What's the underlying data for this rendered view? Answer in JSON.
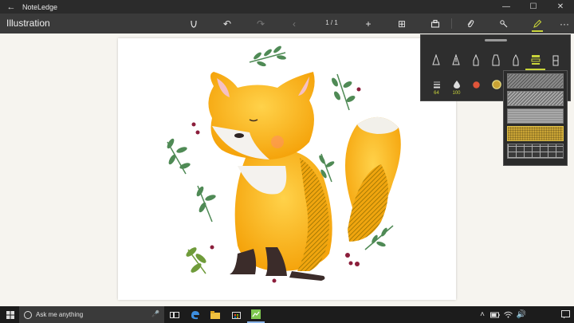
{
  "window": {
    "title": "NoteLedge"
  },
  "toolbar": {
    "doc_title": "Illustration",
    "page_indicator": "1 / 1"
  },
  "pen_panel": {
    "size_value": "64",
    "opacity_value": "100"
  },
  "search": {
    "placeholder": "Ask me anything"
  },
  "colors": {
    "accent": "#c8d43a",
    "ink_color": "#e0553a",
    "fox_orange": "#f5ad12",
    "leaf_green": "#4f8a55"
  },
  "icons": {
    "pens": [
      "fountain-pen-icon",
      "calligraphy-pen-icon",
      "fine-pen-icon",
      "marker-pen-icon",
      "brush-pen-icon",
      "texture-brush-icon",
      "eraser-icon"
    ],
    "texture_options": [
      "coarse-hatch",
      "fine-hatch",
      "horizontal-lines",
      "gold-crosshatch",
      "grid"
    ]
  }
}
